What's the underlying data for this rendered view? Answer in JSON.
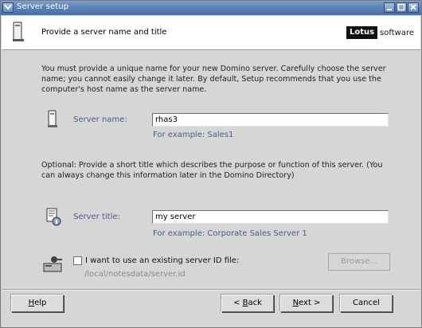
{
  "window": {
    "title": "Server setup"
  },
  "header": {
    "prompt": "Provide a server name and title",
    "brand_mark": "Lotus",
    "brand_text": "software"
  },
  "intro": "You must provide a unique name for your new Domino server. Carefully choose the server name; you cannot easily change it later. By default, Setup recommends that you use the computer's host name as the server name.",
  "server_name": {
    "label": "Server name:",
    "value": "rhas3",
    "example": "For example: Sales1"
  },
  "optional": "Optional: Provide a short title which describes the purpose or function of this server. (You can always change this information later in the Domino Directory)",
  "server_title": {
    "label": "Server title:",
    "value": "my server",
    "example": "For example: Corporate Sales Server 1"
  },
  "id_file": {
    "checkbox_label": "I want to use an existing server ID file:",
    "checked": false,
    "path": "/local/notesdata/server.id",
    "browse_label": "Browse..."
  },
  "buttons": {
    "help_u": "H",
    "help_rest": "elp",
    "back_pre": "< ",
    "back_u": "B",
    "back_rest": "ack",
    "next_u": "N",
    "next_rest": "ext >",
    "cancel": "Cancel"
  },
  "icons": {
    "window_menu": "chevron-down-icon",
    "header": "server-icon",
    "server_name": "server-tower-icon",
    "server_title": "document-info-icon",
    "id_file": "key-disk-icon"
  }
}
